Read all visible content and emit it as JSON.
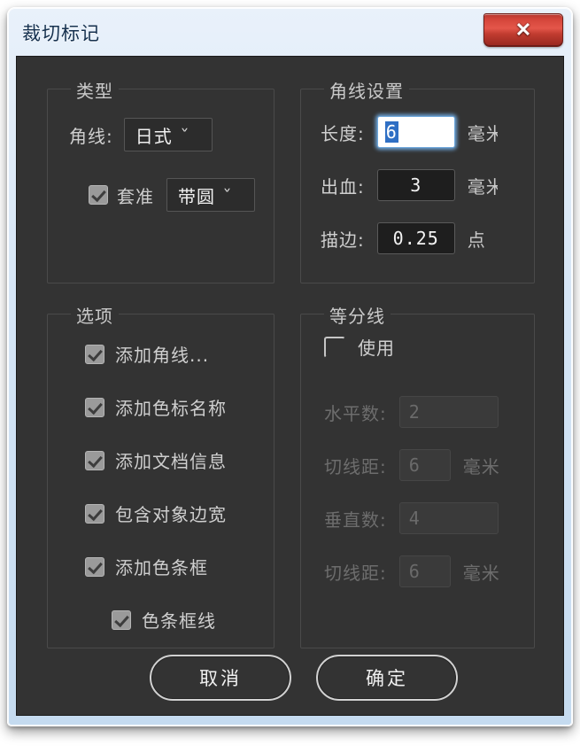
{
  "window": {
    "title": "裁切标记",
    "close_label": "✕",
    "titlebar_color": "#d6e6f6",
    "close_color": "#d4453a",
    "content_bg": "#333333"
  },
  "groups": {
    "type": {
      "label": "类型",
      "corner_mark": {
        "label": "角线:",
        "value": "日式",
        "chevron": "˅"
      },
      "registration": {
        "checkbox_label": "套准",
        "checked": true,
        "value": "带圆",
        "chevron": "˅"
      }
    },
    "mark_settings": {
      "label": "角线设置",
      "fields": [
        {
          "label": "长度:",
          "value": "6",
          "unit": "毫米",
          "focused": true,
          "selected": true,
          "disabled": false
        },
        {
          "label": "出血:",
          "value": "3",
          "unit": "毫米",
          "focused": false,
          "selected": false,
          "disabled": false
        },
        {
          "label": "描边:",
          "value": "0.25",
          "unit": "点",
          "focused": false,
          "selected": false,
          "disabled": false
        }
      ]
    },
    "options": {
      "label": "选项",
      "items": [
        {
          "label": "添加角线...",
          "checked": true,
          "indent": false
        },
        {
          "label": "添加色标名称",
          "checked": true,
          "indent": false
        },
        {
          "label": "添加文档信息",
          "checked": true,
          "indent": false
        },
        {
          "label": "包含对象边宽",
          "checked": true,
          "indent": false
        },
        {
          "label": "添加色条框",
          "checked": true,
          "indent": false
        },
        {
          "label": "色条框线",
          "checked": true,
          "indent": true
        }
      ]
    },
    "division": {
      "label": "等分线",
      "enable": {
        "label": "使用",
        "checked": false
      },
      "fields": [
        {
          "label": "水平数:",
          "value": "2",
          "unit": "",
          "disabled": true
        },
        {
          "label": "切线距:",
          "value": "6",
          "unit": "毫米",
          "disabled": true
        },
        {
          "label": "垂直数:",
          "value": "4",
          "unit": "",
          "disabled": true
        },
        {
          "label": "切线距:",
          "value": "6",
          "unit": "毫米",
          "disabled": true
        }
      ]
    }
  },
  "buttons": {
    "cancel": "取消",
    "ok": "确定"
  }
}
